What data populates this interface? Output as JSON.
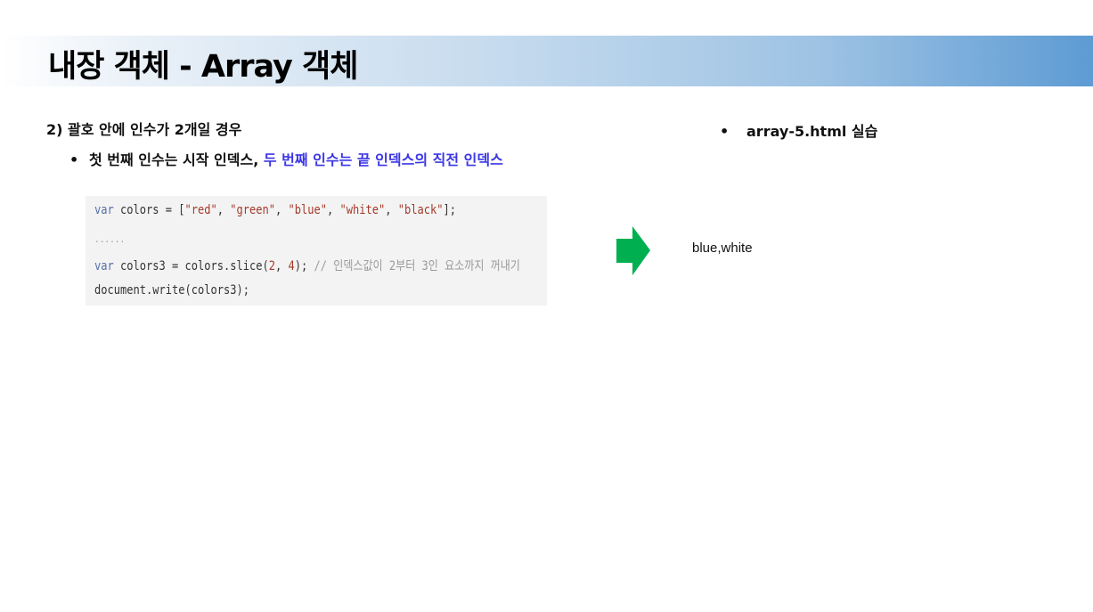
{
  "title": "내장 객체 - Array 객체",
  "section": {
    "heading": "2) 괄호 안에 인수가 2개일 경우",
    "bullet_black": "첫 번째 인수는 시작 인덱스, ",
    "bullet_blue": "두 번째 인수는 끝 인덱스의 직전 인덱스"
  },
  "code": {
    "line1": {
      "kw": "var",
      "rest1": " colors = [",
      "s1": "\"red\"",
      "s2": "\"green\"",
      "s3": "\"blue\"",
      "s4": "\"white\"",
      "s5": "\"black\"",
      "end": "];"
    },
    "ellipsis": "......",
    "line3": {
      "kw": "var",
      "rest1": " colors3 = colors.slice(",
      "n1": "2",
      "n2": "4",
      "end": ");",
      "comment": "// 인덱스값이 2부터 3인 요소까지 꺼내기"
    },
    "line4": "document.write(colors3);"
  },
  "output": "blue,white",
  "practice": "array-5.html 실습",
  "bullet_char": "•",
  "colors": {
    "arrow": "#00b050",
    "highlight": "#3b36e6"
  }
}
